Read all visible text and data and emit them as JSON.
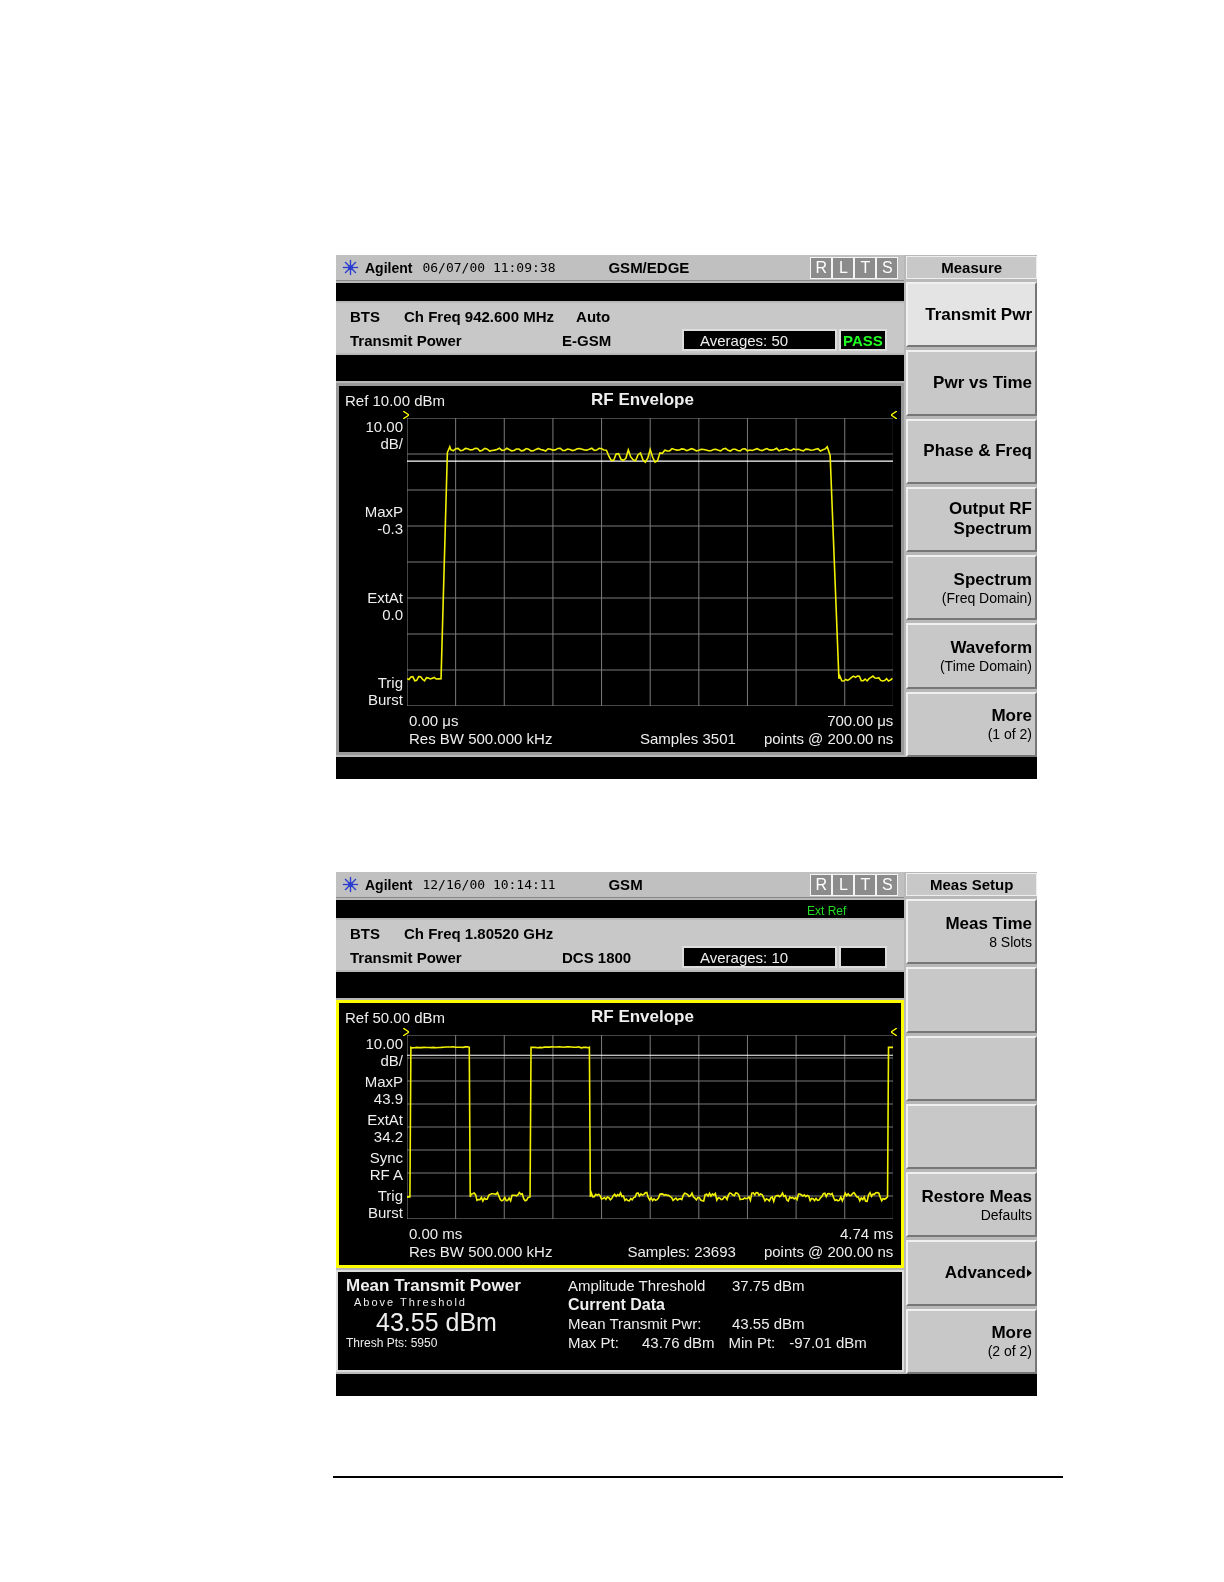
{
  "screens": [
    {
      "title_bar": {
        "brand": "Agilent",
        "datetime": "06/07/00 11:09:38",
        "mode": "GSM/EDGE",
        "indicators": [
          {
            "label": "R",
            "on": false
          },
          {
            "label": "L",
            "on": false
          },
          {
            "label": "T",
            "on": false
          },
          {
            "label": "S",
            "on": false
          }
        ]
      },
      "info": {
        "row1": [
          "BTS",
          "Ch Freq 942.600 MHz",
          "Auto"
        ],
        "row2": [
          "Transmit Power",
          "E-GSM"
        ],
        "averages": "Averages:  50",
        "verdict": "PASS"
      },
      "graph": {
        "active": false,
        "ref": "Ref 10.00 dBm",
        "title": "RF Envelope",
        "kind": "single_burst",
        "axis_labels": [
          [
            "10.00",
            "dB/"
          ],
          [
            "MaxP",
            "-0.3"
          ],
          [
            "ExtAt",
            "0.0"
          ],
          [
            "Trig",
            "Burst"
          ]
        ],
        "x_start": "0.00 μs",
        "x_end": "700.00 μs",
        "footer": [
          "Res BW 500.000 kHz",
          "Samples 3501",
          "points @ 200.00 ns"
        ]
      },
      "menu": {
        "title": "Measure",
        "keys": [
          {
            "label": "Transmit Pwr",
            "selected": true,
            "submenu": false
          },
          {
            "label": "Pwr vs Time",
            "selected": false,
            "submenu": false
          },
          {
            "label": "Phase & Freq",
            "selected": false,
            "submenu": false
          },
          {
            "label": "Output RF",
            "label2": "Spectrum",
            "selected": false,
            "submenu": false
          },
          {
            "label": "Spectrum",
            "sublabel": "(Freq Domain)",
            "selected": false,
            "submenu": false
          },
          {
            "label": "Waveform",
            "sublabel": "(Time Domain)",
            "selected": false,
            "submenu": false
          },
          {
            "label": "More",
            "sublabel": "(1 of 2)",
            "selected": false,
            "submenu": false
          }
        ]
      }
    },
    {
      "title_bar": {
        "brand": "Agilent",
        "datetime": "12/16/00 10:14:11",
        "mode": "GSM",
        "indicators": [
          {
            "label": "R",
            "on": false
          },
          {
            "label": "L",
            "on": false
          },
          {
            "label": "T",
            "on": false
          },
          {
            "label": "S",
            "on": false
          }
        ]
      },
      "status_message": "Ext Ref",
      "info": {
        "row1": [
          "BTS",
          "Ch Freq 1.80520 GHz"
        ],
        "row2": [
          "Transmit Power",
          "DCS 1800"
        ],
        "averages": "Averages: 10"
      },
      "graph": {
        "active": true,
        "ref": "Ref 50.00 dBm",
        "title": "RF Envelope",
        "kind": "multi_burst",
        "axis_labels": [
          [
            "10.00",
            "dB/"
          ],
          [
            "MaxP",
            "43.9"
          ],
          [
            "ExtAt",
            "34.2"
          ],
          [
            "Sync",
            "RF A"
          ],
          [
            "Trig",
            "Burst"
          ]
        ],
        "x_start": "0.00 ms",
        "x_end": "4.74 ms",
        "footer": [
          "Res BW 500.000 kHz",
          "Samples: 23693",
          "points @ 200.00 ns"
        ]
      },
      "results": {
        "title": "Mean Transmit Power",
        "subtitle": "Above Threshold",
        "value": "43.55 dBm",
        "thresh_pts": "Thresh Pts:  5950",
        "lines": [
          {
            "kind": "pair",
            "cells": [
              "Amplitude Threshold",
              "37.75 dBm"
            ]
          },
          {
            "kind": "heading",
            "cells": [
              "Current Data"
            ]
          },
          {
            "kind": "pair",
            "cells": [
              "Mean Transmit Pwr:",
              "43.55 dBm"
            ]
          },
          {
            "kind": "pair",
            "cells": [
              "Max Pt:",
              "43.76 dBm",
              "Min Pt:",
              "-97.01 dBm"
            ]
          }
        ]
      },
      "menu": {
        "title": "Meas Setup",
        "keys": [
          {
            "label": "Meas Time",
            "sublabel": "8 Slots",
            "selected": false,
            "submenu": false
          },
          {
            "selected": false,
            "submenu": false
          },
          {
            "selected": false,
            "submenu": false
          },
          {
            "selected": false,
            "submenu": false
          },
          {
            "label": "Restore Meas",
            "sublabel": "Defaults",
            "selected": false,
            "submenu": false
          },
          {
            "label": "Advanced",
            "selected": false,
            "submenu": true
          },
          {
            "label": "More",
            "sublabel": "(2 of 2)",
            "selected": false,
            "submenu": false
          }
        ]
      }
    }
  ]
}
